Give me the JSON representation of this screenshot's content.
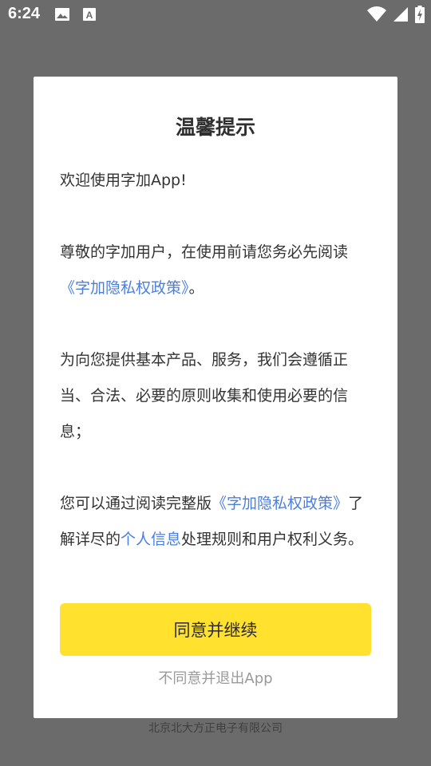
{
  "status_bar": {
    "time": "6:24",
    "left_icons": [
      "image-icon",
      "font-a-icon"
    ],
    "right_icons": [
      "wifi-icon",
      "cellular-signal-icon",
      "battery-charging-icon"
    ]
  },
  "background": {
    "footer_text": "北京北大方正电子有限公司"
  },
  "dialog": {
    "title": "温馨提示",
    "welcome": "欢迎使用字加App!",
    "p1_text": "尊敬的字加用户，在使用前请您务必先阅读",
    "p1_link": "《字加隐私权政策》",
    "p1_end": "。",
    "p2_text": "为向您提供基本产品、服务，我们会遵循正当、合法、必要的原则收集和使用必要的信息；",
    "p3_text1": "您可以通过阅读完整版",
    "p3_link1": "《字加隐私权政策》",
    "p3_text2": "了解详尽的",
    "p3_link2": "个人信息",
    "p3_text3": "处理规则和用户权利义务。",
    "agree_button": "同意并继续",
    "decline_link": "不同意并退出App"
  },
  "colors": {
    "accent_yellow": "#ffe12e",
    "link_blue": "#4a7fe0",
    "overlay": "#6b6b6b"
  }
}
